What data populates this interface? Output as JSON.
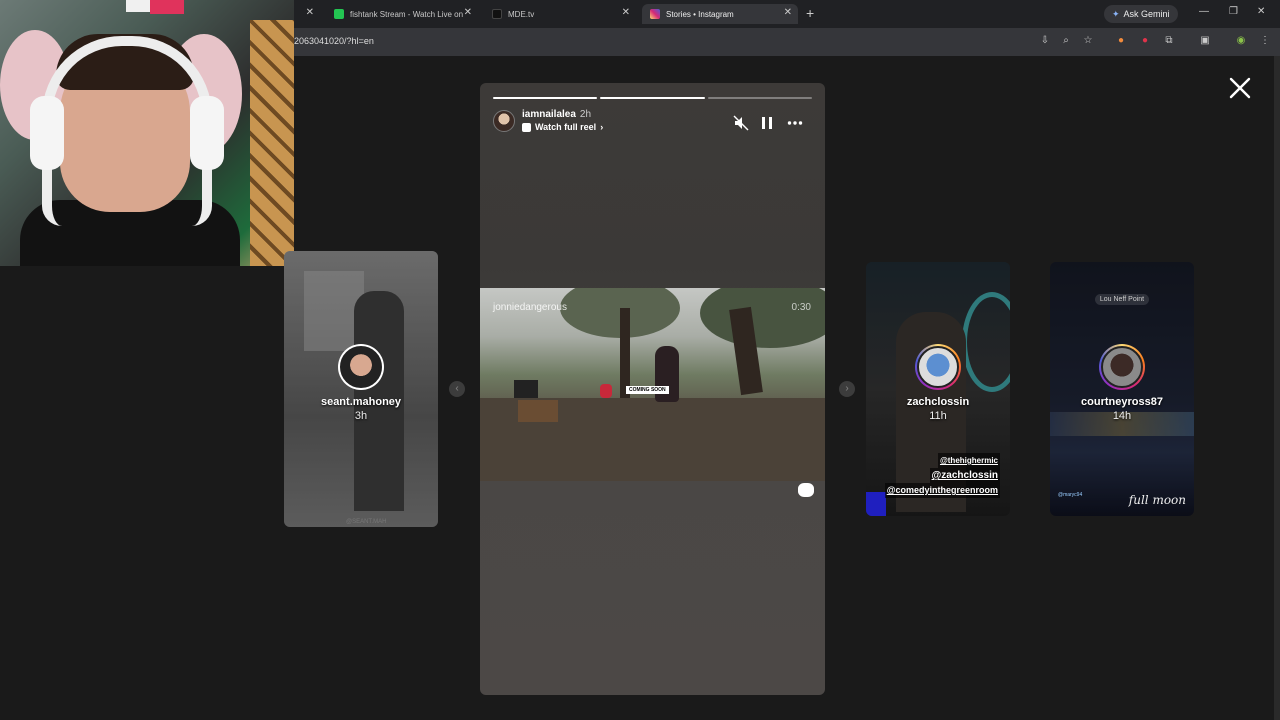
{
  "browser": {
    "tabs": [
      {
        "label": "fishtank Stream - Watch Live on",
        "icon": "fishtank-favicon",
        "color": "#23c552"
      },
      {
        "label": "MDE.tv",
        "icon": "mde-favicon",
        "color": "#111111"
      },
      {
        "label": "Stories • Instagram",
        "icon": "instagram-favicon",
        "color": "#e1306c",
        "active": true
      }
    ],
    "new_tab": "+",
    "ask_gemini": "Ask Gemini",
    "url": "2063041020/?hl=en",
    "window_controls": {
      "minimize": "—",
      "restore": "❐",
      "close": "✕"
    }
  },
  "stories": {
    "close_label": "✕",
    "main": {
      "username": "iamnailalea",
      "time": "2h",
      "watch_full_reel": "Watch full reel",
      "video_user": "jonniedangerous",
      "video_time": "0:30",
      "coming_soon": "COMING SOON",
      "progress_done": 2,
      "progress_total": 3
    },
    "left": {
      "username": "seant.mahoney",
      "time": "3h",
      "caption": "@SEANT.MAH"
    },
    "right1": {
      "username": "zachclossin",
      "time": "11h",
      "tags": [
        "@thehighermic",
        "@zachclossin",
        "@comedyinthegreenroom"
      ]
    },
    "right2": {
      "username": "courtneyross87",
      "time": "14h",
      "place": "Lou Neff Point",
      "signature": "full moon",
      "handle": "@maryc94"
    }
  }
}
